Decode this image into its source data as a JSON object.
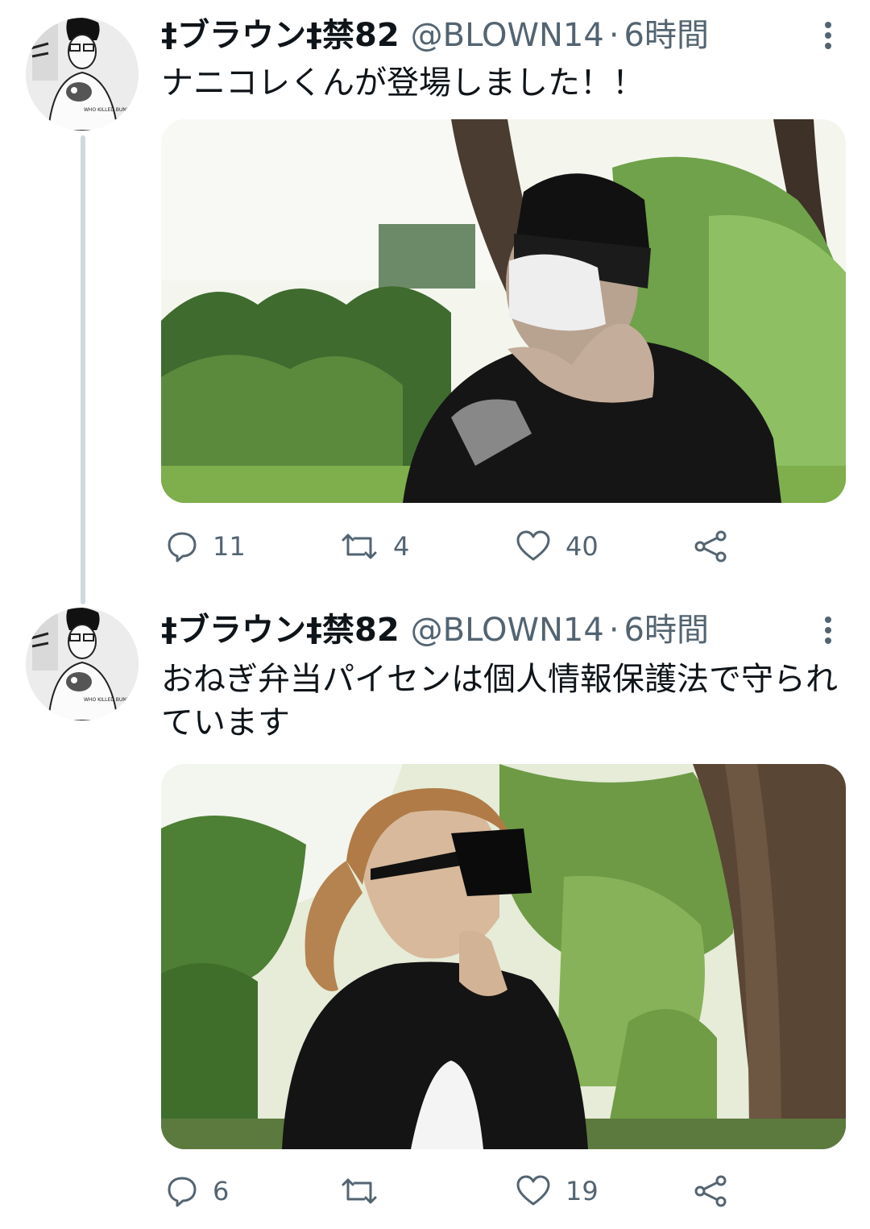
{
  "tweets": [
    {
      "display_name": "‡ブラウン‡禁82",
      "handle": "@BLOWN14",
      "separator": "·",
      "time": "6時間",
      "text": "ナニコレくんが登場しました！！",
      "avatar_shirt_text": "WHO KILLED BUNNY",
      "stats": {
        "replies": "11",
        "retweets": "4",
        "likes": "40"
      },
      "icons": {
        "reply": "reply-icon",
        "retweet": "retweet-icon",
        "like": "heart-icon",
        "share": "share-icon",
        "more": "more-vertical-icon"
      }
    },
    {
      "display_name": "‡ブラウン‡禁82",
      "handle": "@BLOWN14",
      "separator": "·",
      "time": "6時間",
      "text": "おねぎ弁当パイセンは個人情報保護法で守られています",
      "avatar_shirt_text": "WHO KILLED BUNNY",
      "stats": {
        "replies": "6",
        "retweets": "",
        "likes": "19"
      },
      "icons": {
        "reply": "reply-icon",
        "retweet": "retweet-icon",
        "like": "heart-icon",
        "share": "share-icon",
        "more": "more-vertical-icon"
      }
    }
  ],
  "colors": {
    "text_primary": "#0f1419",
    "text_secondary": "#536471",
    "thread_line": "#cfd9de"
  }
}
